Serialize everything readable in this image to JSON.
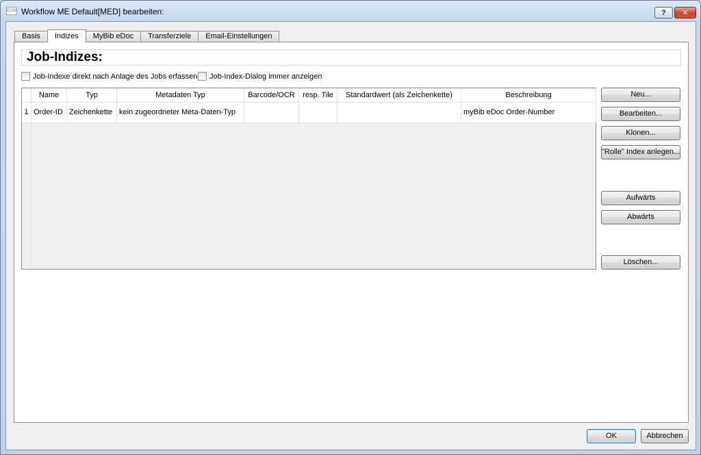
{
  "window": {
    "title": "Workflow ME Default[MED] bearbeiten:",
    "app_icon_text": "ECHO"
  },
  "titlebar": {
    "help_label": "?",
    "close_label": "✕"
  },
  "tabs": [
    {
      "label": "Basis",
      "active": false
    },
    {
      "label": "Indizes",
      "active": true
    },
    {
      "label": "MyBib eDoc",
      "active": false
    },
    {
      "label": "Transferziele",
      "active": false
    },
    {
      "label": "Email-Einstellungen",
      "active": false
    }
  ],
  "page": {
    "heading": "Job-Indizes:",
    "checkbox_capture": "Job-Indexe direkt nach Anlage des Jobs erfassen",
    "checkbox_dialog": "Job-Index-Dialog immer anzeigen"
  },
  "table": {
    "columns": [
      "Name",
      "Typ",
      "Metadaten Typ",
      "Barcode/OCR",
      "resp. Tile",
      "Standardwert (als Zeichenkette)",
      "Beschreibung"
    ],
    "rows": [
      {
        "num": "1",
        "cells": [
          "Order-ID",
          "Zeichenkette",
          "kein zugeordneter Meta-Daten-Typ",
          "",
          "",
          "",
          "myBib eDoc Order-Number"
        ]
      }
    ]
  },
  "buttons": {
    "new": "Neu...",
    "edit": "Bearbeiten...",
    "clone": "Klonen...",
    "role_index": "\"Rolle\" Index anlegen...",
    "up": "Aufwärts",
    "down": "Abwärts",
    "delete": "Löschen..."
  },
  "footer": {
    "ok": "OK",
    "cancel": "Abbrechen"
  }
}
